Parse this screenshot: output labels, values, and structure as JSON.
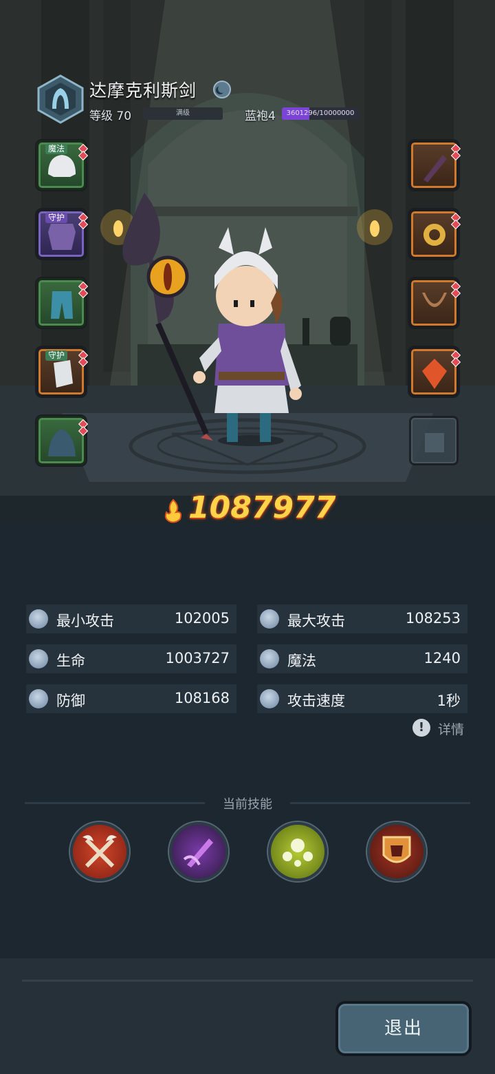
{
  "hero": {
    "name": "达摩克利斯剑",
    "level_label": "等级 70",
    "level_bar_text": "满级",
    "rank_label": "蓝袍4",
    "rank_progress_text": "3601296/10000000",
    "rank_progress_fraction": 0.36
  },
  "equipment": {
    "left": [
      {
        "tag": "魔法",
        "icon": "helmet-icon",
        "quality": "green"
      },
      {
        "tag": "守护",
        "icon": "armor-icon",
        "quality": "purple"
      },
      {
        "tag": "",
        "icon": "pants-icon",
        "quality": "green"
      },
      {
        "tag": "守护",
        "icon": "bracer-icon",
        "quality": "orange"
      },
      {
        "tag": "",
        "icon": "cloak-icon",
        "quality": "green"
      }
    ],
    "right": [
      {
        "tag": "",
        "icon": "staff-weapon-icon",
        "quality": "orange"
      },
      {
        "tag": "",
        "icon": "ring-icon",
        "quality": "orange"
      },
      {
        "tag": "",
        "icon": "necklace-icon",
        "quality": "orange"
      },
      {
        "tag": "",
        "icon": "gem-amulet-icon",
        "quality": "orange"
      },
      {
        "tag": "",
        "icon": "empty-slot-icon",
        "quality": "empty"
      }
    ]
  },
  "power": {
    "icon": "flame-power-icon",
    "value": "1087977"
  },
  "stats": {
    "min_attack": {
      "label": "最小攻击",
      "value": "102005",
      "icon": "sword-icon"
    },
    "max_attack": {
      "label": "最大攻击",
      "value": "108253",
      "icon": "sword-icon"
    },
    "hp": {
      "label": "生命",
      "value": "1003727",
      "icon": "heart-icon"
    },
    "magic": {
      "label": "魔法",
      "value": "1240",
      "icon": "magic-swirl-icon"
    },
    "defense": {
      "label": "防御",
      "value": "108168",
      "icon": "shield-icon"
    },
    "attack_speed": {
      "label": "攻击速度",
      "value": "1秒",
      "icon": "speed-icon"
    }
  },
  "details": {
    "label": "详情",
    "icon": "info-icon"
  },
  "skills": {
    "title": "当前技能",
    "items": [
      {
        "icon": "crossed-axes-skill-icon",
        "color": "#b2301e"
      },
      {
        "icon": "purple-blade-skill-icon",
        "color": "#5a2e7e"
      },
      {
        "icon": "green-orbs-skill-icon",
        "color": "#8ea81c"
      },
      {
        "icon": "shield-helmet-skill-icon",
        "color": "#8b2a1e"
      }
    ]
  },
  "footer": {
    "exit_label": "退出"
  }
}
